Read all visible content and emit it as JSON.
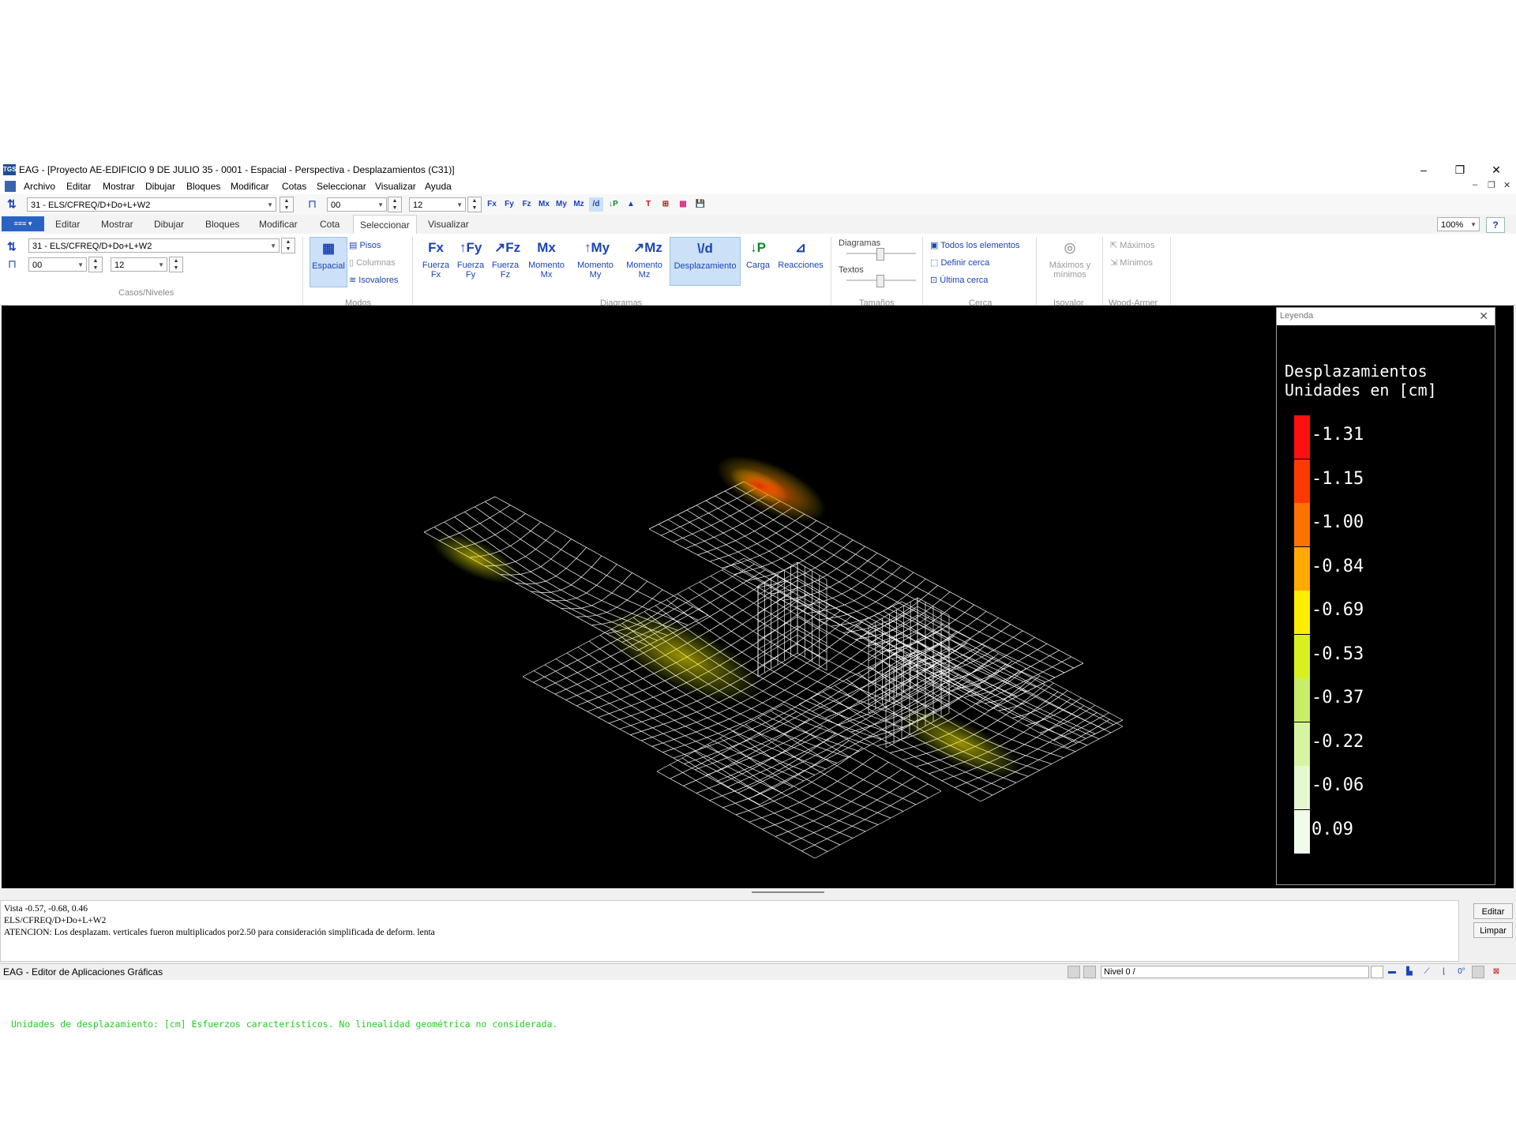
{
  "window": {
    "title": "EAG - [Proyecto AE-EDIFICIO 9 DE JULIO 35 - 0001 - Espacial - Perspectiva - Desplazamientos (C31)]",
    "logo": "TGS",
    "minimize": "–",
    "restore": "❐",
    "close": "✕"
  },
  "menu": [
    "Archivo",
    "Editar",
    "Mostrar",
    "Dibujar",
    "Bloques",
    "Modificar",
    "Cotas",
    "Seleccionar",
    "Visualizar",
    "Ayuda"
  ],
  "toolbar": {
    "case": "31 - ELS/CFREQ/D+Do+L+W2",
    "level_from": "00",
    "level_to": "12",
    "icons": [
      "Fx",
      "Fy",
      "Fz",
      "Mx",
      "My",
      "Mz",
      "/d",
      "↓P",
      "▲",
      "T",
      "⊞",
      "▦",
      "💾"
    ]
  },
  "tabs": {
    "file": "≡≡≡ ▾",
    "items": [
      "Editar",
      "Mostrar",
      "Dibujar",
      "Bloques",
      "Modificar",
      "Cota",
      "Seleccionar",
      "Visualizar"
    ],
    "active": "Seleccionar",
    "zoom": "100%",
    "help": "?"
  },
  "ribbon": {
    "case": "31 - ELS/CFREQ/D+Do+L+W2",
    "level_from": "00",
    "level_to": "12",
    "groups": {
      "casos": "Casos/Niveles",
      "modos": "Modos",
      "diagramas": "Diagramas",
      "tamanos": "Tamaños",
      "cerca": "Cerca",
      "isovalor": "Isovalor",
      "wood": "Wood-Armer"
    },
    "modos": {
      "espacial": "Espacial",
      "pisos": "Pisos",
      "columnas": "Columnas",
      "isovalores": "Isovalores"
    },
    "diagramas": [
      {
        "icon": "Fx",
        "line1": "Fuerza",
        "line2": "Fx"
      },
      {
        "icon": "↑Fy",
        "line1": "Fuerza",
        "line2": "Fy"
      },
      {
        "icon": "↗Fz",
        "line1": "Fuerza",
        "line2": "Fz"
      },
      {
        "icon": "Mx",
        "line1": "Momento",
        "line2": "Mx"
      },
      {
        "icon": "↑My",
        "line1": "Momento",
        "line2": "My"
      },
      {
        "icon": "↗Mz",
        "line1": "Momento",
        "line2": "Mz"
      }
    ],
    "desplazamiento": {
      "icon": "\\/d",
      "label": "Desplazamiento"
    },
    "carga": {
      "icon": "↓P",
      "label": "Carga"
    },
    "reacciones": {
      "icon": "⊿",
      "label": "Reacciones"
    },
    "tamanos": {
      "diagramas": "Diagramas",
      "textos": "Textos"
    },
    "cerca": {
      "todos": "Todos los elementos",
      "definir": "Definir cerca",
      "ultima": "Última cerca"
    },
    "isovalor": {
      "line1": "Máximos y",
      "line2": "mínimos"
    },
    "wood": {
      "maximos": "Máximos",
      "minimos": "Mínimos"
    }
  },
  "legend": {
    "header": "Leyenda",
    "close": "✕",
    "title1": "Desplazamientos",
    "title2": "Unidades en [cm]",
    "items": [
      {
        "value": "-1.31",
        "color": "#ff1010"
      },
      {
        "value": "-1.15",
        "color": "#ff3a00"
      },
      {
        "value": "-1.00",
        "color": "#ff7200"
      },
      {
        "value": "-0.84",
        "color": "#ffaa00"
      },
      {
        "value": "-0.69",
        "color": "#ffee00"
      },
      {
        "value": "-0.53",
        "color": "#d8f020"
      },
      {
        "value": "-0.37",
        "color": "#c8ee68"
      },
      {
        "value": "-0.22",
        "color": "#d6f4a2"
      },
      {
        "value": "-0.06",
        "color": "#e6f8d0"
      },
      {
        "value": "0.09",
        "color": "#f0fbec"
      }
    ]
  },
  "viewport": {
    "status": "Unidades de desplazamiento: [cm] Esfuerzos característicos. No linealidad geométrica no considerada.",
    "mesh_color": "#ffffff"
  },
  "console": {
    "lines": [
      "Vista    -0.57,    -0.68,    0.46",
      "ELS/CFREQ/D+Do+L+W2",
      "ATENCION: Los desplazam. verticales fueron multiplicados por2.50 para consideración simplificada de deform. lenta"
    ],
    "editar": "Editar",
    "limpar": "Limpar"
  },
  "statusbar": {
    "text": "EAG - Editor de Aplicaciones Gráficas",
    "nivel": "Nivel 0 /"
  }
}
